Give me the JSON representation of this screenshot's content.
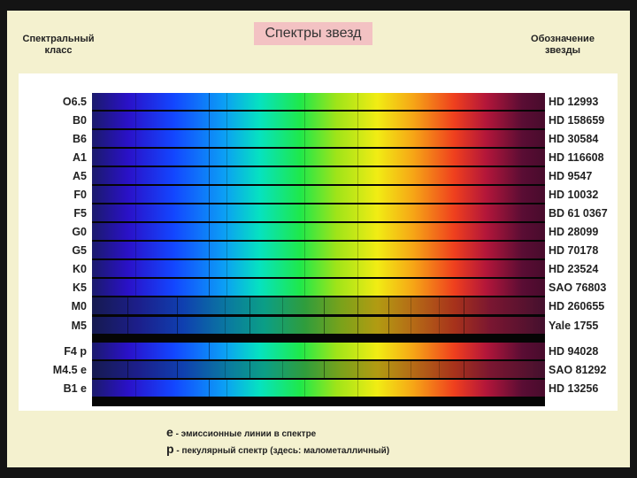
{
  "title": "Спектры звезд",
  "left_header": [
    "Спектральный",
    "класс"
  ],
  "right_header": [
    "Обозначение",
    "звезды"
  ],
  "rows": [
    {
      "class": "O6.5",
      "star": "HD 12993",
      "type": "hot"
    },
    {
      "class": "B0",
      "star": "HD 158659",
      "type": "hot"
    },
    {
      "class": "B6",
      "star": "HD 30584",
      "type": "hot"
    },
    {
      "class": "A1",
      "star": "HD 116608",
      "type": "hot"
    },
    {
      "class": "A5",
      "star": "HD 9547",
      "type": "hot"
    },
    {
      "class": "F0",
      "star": "HD 10032",
      "type": "hot"
    },
    {
      "class": "F5",
      "star": "BD 61 0367",
      "type": "hot"
    },
    {
      "class": "G0",
      "star": "HD 28099",
      "type": "hot"
    },
    {
      "class": "G5",
      "star": "HD 70178",
      "type": "hot"
    },
    {
      "class": "K0",
      "star": "HD 23524",
      "type": "hot"
    },
    {
      "class": "K5",
      "star": "SAO 76803",
      "type": "hot"
    },
    {
      "class": "M0",
      "star": "HD 260655",
      "type": "cool"
    },
    {
      "class": "M5",
      "star": "Yale 1755",
      "type": "cool"
    },
    {
      "class": "F4 p",
      "star": "HD 94028",
      "type": "hot"
    },
    {
      "class": "M4.5 e",
      "star": "SAO 81292",
      "type": "cool"
    },
    {
      "class": "B1 e",
      "star": "HD 13256",
      "type": "hot"
    }
  ],
  "legend": [
    {
      "key": "e",
      "text": " -  эмиссионные линии в спектре"
    },
    {
      "key": "p",
      "text": " - пекулярный спектр (здесь: малометалличный)"
    }
  ],
  "colors": {
    "slide_bg": "#f4f1cf",
    "title_bg": "#f3c2c3",
    "frame_bg": "#141414"
  }
}
